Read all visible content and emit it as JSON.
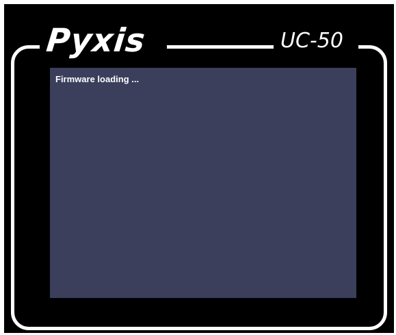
{
  "device": {
    "brand": "Pyxis",
    "model": "UC-50"
  },
  "screen": {
    "status_message": "Firmware loading ..."
  },
  "colors": {
    "frame_background": "#000000",
    "bezel_line": "#ffffff",
    "screen_background": "#3b3f5c",
    "text": "#ffffff"
  }
}
